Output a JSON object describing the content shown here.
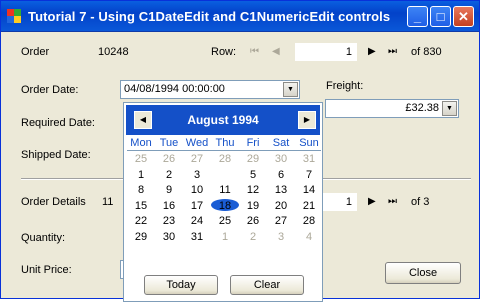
{
  "window": {
    "title": "Tutorial 7 - Using C1DateEdit and C1NumericEdit controls",
    "minimize": "_",
    "maximize": "□",
    "close": "✕"
  },
  "order": {
    "label": "Order",
    "value": "10248"
  },
  "row_nav": {
    "label": "Row:",
    "value": "1",
    "of_text": "of 830"
  },
  "order_date": {
    "label": "Order Date:",
    "value": "04/08/1994 00:00:00"
  },
  "required_date": {
    "label": "Required Date:"
  },
  "shipped_date": {
    "label": "Shipped Date:"
  },
  "freight": {
    "label": "Freight:",
    "value": "£32.38"
  },
  "order_details": {
    "label": "Order Details",
    "value": "11",
    "row_value": "1",
    "of_text": "of 3"
  },
  "quantity": {
    "label": "Quantity:"
  },
  "unit_price": {
    "label": "Unit Price:"
  },
  "close_button": {
    "label": "Close"
  },
  "calendar": {
    "month_title": "August 1994",
    "prev": "◀",
    "next": "▶",
    "weekdays": [
      "Mon",
      "Tue",
      "Wed",
      "Thu",
      "Fri",
      "Sat",
      "Sun"
    ],
    "weeks": [
      [
        "25",
        "26",
        "27",
        "28",
        "29",
        "30",
        "31"
      ],
      [
        "1",
        "2",
        "3",
        "4",
        "5",
        "6",
        "7"
      ],
      [
        "8",
        "9",
        "10",
        "11",
        "12",
        "13",
        "14"
      ],
      [
        "15",
        "16",
        "17",
        "18",
        "19",
        "20",
        "21"
      ],
      [
        "22",
        "23",
        "24",
        "25",
        "26",
        "27",
        "28"
      ],
      [
        "29",
        "30",
        "31",
        "1",
        "2",
        "3",
        "4"
      ]
    ],
    "selected_day": "4",
    "today_button": "Today",
    "clear_button": "Clear"
  },
  "icons": {
    "first": "⏮",
    "prev": "◀",
    "next": "▶",
    "last": "⏭",
    "dropdown": "▼"
  }
}
